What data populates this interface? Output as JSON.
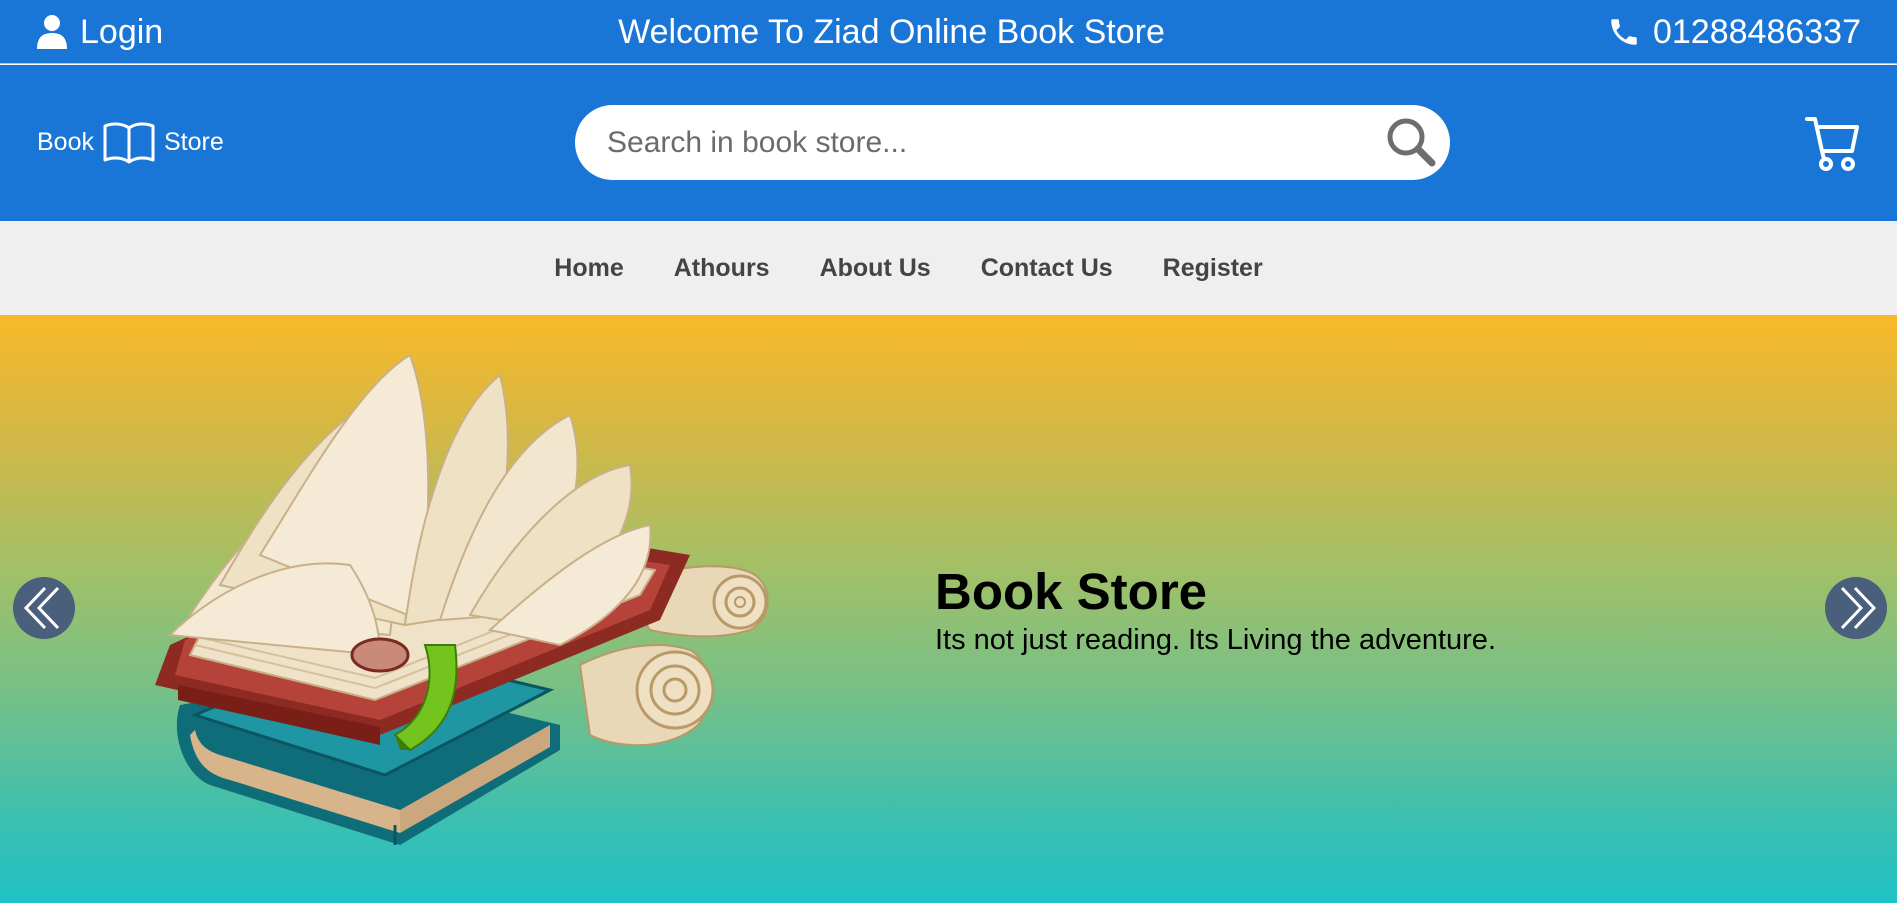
{
  "topbar": {
    "login_label": "Login",
    "welcome_text": "Welcome To Ziad Online Book Store",
    "phone_number": "01288486337",
    "user_icon": "user-icon",
    "phone_icon": "phone-icon"
  },
  "header": {
    "logo_left": "Book",
    "logo_right": "Store",
    "logo_icon": "open-book-icon",
    "search_placeholder": "Search in book store...",
    "search_icon": "search-icon",
    "cart_icon": "cart-icon"
  },
  "nav": {
    "items": [
      {
        "label": "Home"
      },
      {
        "label": "Athours"
      },
      {
        "label": "About Us"
      },
      {
        "label": "Contact Us"
      },
      {
        "label": "Register"
      }
    ]
  },
  "hero": {
    "title": "Book Store",
    "subtitle": "Its not just reading. Its Living the adventure.",
    "image": "open-book-illustration",
    "prev_icon": "double-chevron-left-icon",
    "next_icon": "double-chevron-right-icon"
  },
  "colors": {
    "primary": "#1a76d6",
    "nav_bg": "#efefef",
    "nav_text": "#444444",
    "hero_top": "#f8b929",
    "hero_bottom": "#1fc2c6",
    "arrow_bg": "#4a5f7c"
  }
}
